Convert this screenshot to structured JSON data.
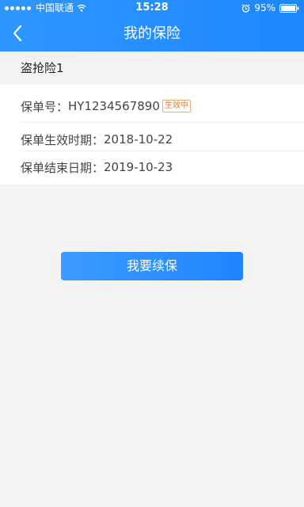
{
  "status_bar": {
    "carrier": "中国联通",
    "time": "15:28",
    "battery": "95%",
    "icons": [
      "signal-dots-icon",
      "wifi-icon",
      "alarm-icon",
      "battery-icon"
    ]
  },
  "nav": {
    "title": "我的保险",
    "back_icon": "chevron-left-icon"
  },
  "policy": {
    "name": "盗抢险1",
    "number_label": "保单号：",
    "number_value": "HY1234567890",
    "status_badge": "生效中",
    "start_label": "保单生效时期：",
    "start_value": "2018-10-22",
    "end_label": "保单结束日期：",
    "end_value": "2019-10-23"
  },
  "actions": {
    "renew_label": "我要续保"
  },
  "colors": {
    "header_blue": "#1e86ff",
    "badge_orange": "#f0762b",
    "page_background": "#f3f3f3"
  }
}
